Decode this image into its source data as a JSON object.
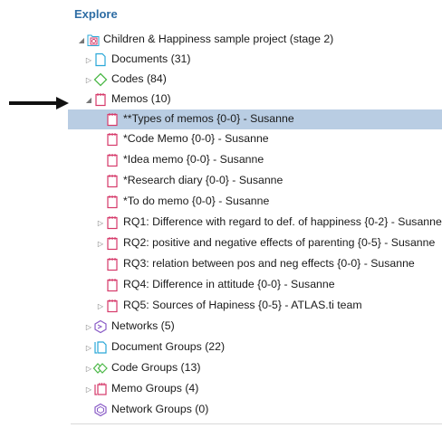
{
  "panel": {
    "title": "Explore"
  },
  "tree": [
    {
      "label": "Children & Happiness sample project (stage 2)",
      "icon": "project-icon",
      "expanded": true
    },
    {
      "label": "Documents (31)",
      "icon": "document-icon"
    },
    {
      "label": "Codes (84)",
      "icon": "code-icon"
    },
    {
      "label": "Memos (10)",
      "icon": "memo-icon",
      "expanded": true
    },
    {
      "label": "**Types of memos {0-0} - Susanne",
      "icon": "memo-icon",
      "selected": true
    },
    {
      "label": "*Code Memo {0-0} - Susanne",
      "icon": "memo-icon"
    },
    {
      "label": "*Idea memo {0-0} - Susanne",
      "icon": "memo-icon"
    },
    {
      "label": "*Research diary {0-0} - Susanne",
      "icon": "memo-icon"
    },
    {
      "label": "*To do memo {0-0} - Susanne",
      "icon": "memo-icon"
    },
    {
      "label": "RQ1: Difference with regard to def. of happiness {0-2} - Susanne",
      "icon": "memo-icon"
    },
    {
      "label": "RQ2: positive and negative effects of parenting {0-5} - Susanne",
      "icon": "memo-icon"
    },
    {
      "label": "RQ3: relation between pos and neg effects {0-0} - Susanne",
      "icon": "memo-icon"
    },
    {
      "label": "RQ4: Difference in attitude {0-0} - Susanne",
      "icon": "memo-icon"
    },
    {
      "label": "RQ5: Sources of Hapiness {0-5} - ATLAS.ti team",
      "icon": "memo-icon"
    },
    {
      "label": "Networks (5)",
      "icon": "network-icon"
    },
    {
      "label": "Document Groups (22)",
      "icon": "document-group-icon"
    },
    {
      "label": "Code Groups (13)",
      "icon": "code-group-icon"
    },
    {
      "label": "Memo Groups (4)",
      "icon": "memo-group-icon"
    },
    {
      "label": "Network Groups (0)",
      "icon": "network-group-icon"
    }
  ],
  "colors": {
    "accent": "#2e6da4",
    "selection": "#b9cde3",
    "document": "#2aa8d8",
    "code": "#4cb848",
    "memo": "#d63a6a",
    "network": "#8a5cc7"
  }
}
